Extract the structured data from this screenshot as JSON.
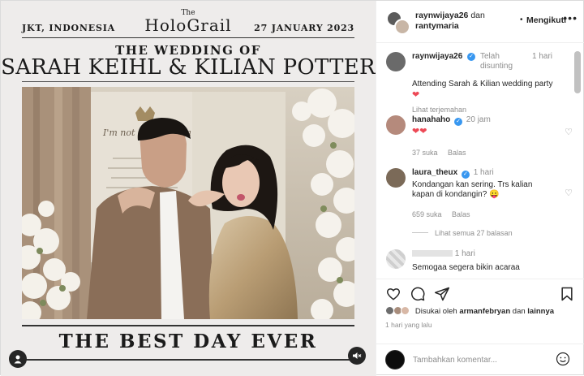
{
  "post": {
    "location": "JKT, INDONESIA",
    "brand_small": "The",
    "brand": "HoloGrail",
    "date": "27 JANUARY 2023",
    "headline": "THE WEDDING OF",
    "names": "SARAH KEIHL & KILIAN POTTER",
    "tagline": "THE BEST DAY EVER",
    "backdrop_text": "I'm not asking for a"
  },
  "header": {
    "user1": "raynwijaya26",
    "joiner": "dan",
    "user2": "rantymaria",
    "dot": "•",
    "follow_label": "Mengikuti",
    "more": "•••"
  },
  "comments": [
    {
      "user": "raynwijaya26",
      "status": "Telah disunting",
      "time": "1 hari",
      "text": "Attending Sarah & Kilian wedding party",
      "emoji": "❤",
      "translate": "Lihat terjemahan"
    },
    {
      "user": "hanahaho",
      "time": "20 jam",
      "emoji": "❤❤",
      "likes": "37 suka",
      "reply": "Balas"
    },
    {
      "user": "laura_theux",
      "time": "1 hari",
      "text": "Kondangan kan sering. Trs kalian kapan di kondangin? 😛",
      "likes": "659 suka",
      "reply": "Balas",
      "see_replies": "Lihat semua 27 balasan"
    },
    {
      "time": "1 hari",
      "text": "Semogaa segera bikin acaraa"
    }
  ],
  "actions": {
    "liked_by_prefix": "Disukai oleh",
    "liked_by_user": "armanfebryan",
    "liked_by_and": "dan",
    "liked_by_rest": "lainnya",
    "time_ago": "1 hari yang lalu"
  },
  "add_comment": {
    "placeholder": "Tambahkan komentar..."
  },
  "icons": [
    "user-icon",
    "speaker-mute-icon",
    "heart-icon",
    "comment-icon",
    "share-icon",
    "bookmark-icon",
    "emoji-icon",
    "verified-icon",
    "more-icon"
  ],
  "colors": {
    "verified": "#3897f0",
    "heart": "#ed4956",
    "muted_text": "#8e8e8e",
    "border": "#efefef"
  }
}
